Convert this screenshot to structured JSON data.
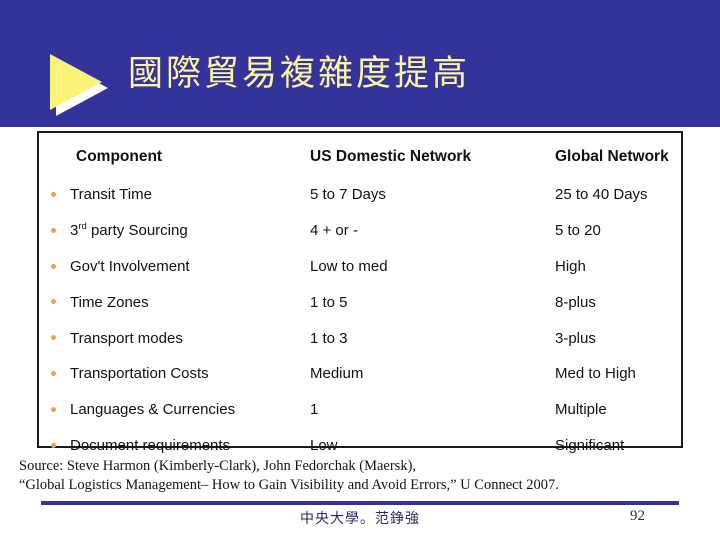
{
  "slide": {
    "title": "國際貿易複雜度提高",
    "title_band_color": "#333399",
    "title_text_color": "#fdf6a0",
    "arrow_color": "#fbf37a",
    "bullet_color": "#e8a34c"
  },
  "table": {
    "headers": {
      "component": "Component",
      "us_domestic": "US Domestic Network",
      "global": "Global Network"
    },
    "rows": [
      {
        "component": "Transit Time",
        "component_sup": "",
        "us": "5 to 7 Days",
        "global": "25 to 40 Days"
      },
      {
        "component": "3",
        "component_sup": "rd",
        "component_rest": " party Sourcing",
        "us": "4 + or -",
        "global": "5 to 20"
      },
      {
        "component": "Gov't Involvement",
        "component_sup": "",
        "us": "Low to med",
        "global": "High"
      },
      {
        "component": "Time Zones",
        "component_sup": "",
        "us": "1 to 5",
        "global": "8-plus"
      },
      {
        "component": "Transport modes",
        "component_sup": "",
        "us": "1 to 3",
        "global": "3-plus"
      },
      {
        "component": "Transportation Costs",
        "component_sup": "",
        "us": "Medium",
        "global": "Med to High"
      },
      {
        "component": "Languages & Currencies",
        "component_sup": "",
        "us": "1",
        "global": "Multiple"
      },
      {
        "component": "Document requirements",
        "component_sup": "",
        "us": "Low",
        "global": "Significant"
      }
    ]
  },
  "source": {
    "line1": "Source: Steve Harmon (Kimberly-Clark), John Fedorchak (Maersk),",
    "line2": "“Global Logistics Management– How to Gain Visibility and Avoid Errors,” U Connect 2007."
  },
  "footer": {
    "center_text": "中央大學。范錚強",
    "page_number": "92",
    "rule_color": "#333399"
  }
}
